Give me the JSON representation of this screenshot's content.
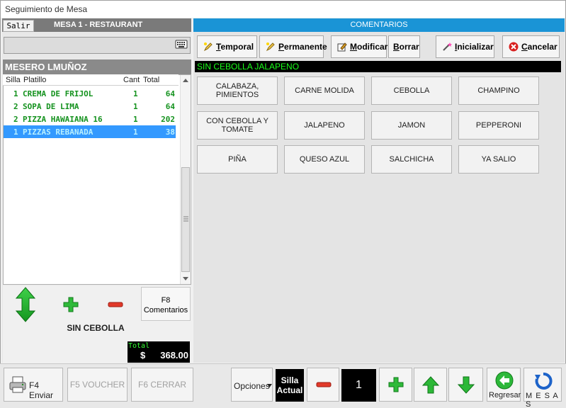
{
  "window": {
    "title": "Seguimiento de Mesa"
  },
  "left": {
    "salir_label": "Salir",
    "mesa_title": "MESA 1 - RESTAURANT",
    "search_value": "",
    "waiter": "MESERO LMUÑOZ",
    "columns": [
      "Silla",
      "Platillo",
      "Cant",
      "Total"
    ],
    "rows": [
      {
        "silla": "1",
        "platillo": "CREMA DE FRIJOL",
        "cant": "1",
        "total": "64"
      },
      {
        "silla": "2",
        "platillo": "SOPA DE LIMA",
        "cant": "1",
        "total": "64"
      },
      {
        "silla": "2",
        "platillo": "PIZZA HAWAIANA 16",
        "cant": "1",
        "total": "202"
      },
      {
        "silla": "1",
        "platillo": "PIZZAS REBANADA",
        "cant": "1",
        "total": "38"
      }
    ],
    "selected_row": 3,
    "f8_line1": "F8",
    "f8_line2": "Comentarios",
    "selected_comment": "SIN CEBOLLA",
    "total_label": "Total",
    "total_currency": "$",
    "total_value": "368.00"
  },
  "right": {
    "header": "COMENTARIOS",
    "toolbar": {
      "temporal": {
        "u": "T",
        "rest": "emporal"
      },
      "permanente": {
        "u": "P",
        "rest": "ermanente"
      },
      "modificar": {
        "u": "M",
        "rest": "odificar"
      },
      "borrar": {
        "u": "B",
        "rest": "orrar"
      },
      "inicializar": {
        "u": "I",
        "rest": "nicializar"
      },
      "cancelar": {
        "u": "C",
        "rest": "ancelar"
      }
    },
    "comment_text": "SIN CEBOLLA JALAPENO",
    "options": [
      [
        "CALABAZA, PIMIENTOS",
        "CARNE MOLIDA",
        "CEBOLLA",
        "CHAMPINO"
      ],
      [
        "CON CEBOLLA Y TOMATE",
        "JALAPENO",
        "JAMON",
        "PEPPERONI"
      ],
      [
        "PIÑA",
        "QUESO AZUL",
        "SALCHICHA",
        "YA  SALIO"
      ]
    ]
  },
  "bottom": {
    "f4": "F4 Enviar",
    "f5": "F5 VOUCHER",
    "f6": "F6 CERRAR",
    "opciones": "Opciones",
    "silla_line1": "Silla",
    "silla_line2": "Actual",
    "silla_value": "1",
    "regresar": "Regresar",
    "mesas": "M E S A S"
  },
  "colors": {
    "accent": "#1a94d6",
    "item_green": "#14921e",
    "selection": "#3399ff",
    "comment_green": "#19ff19"
  }
}
